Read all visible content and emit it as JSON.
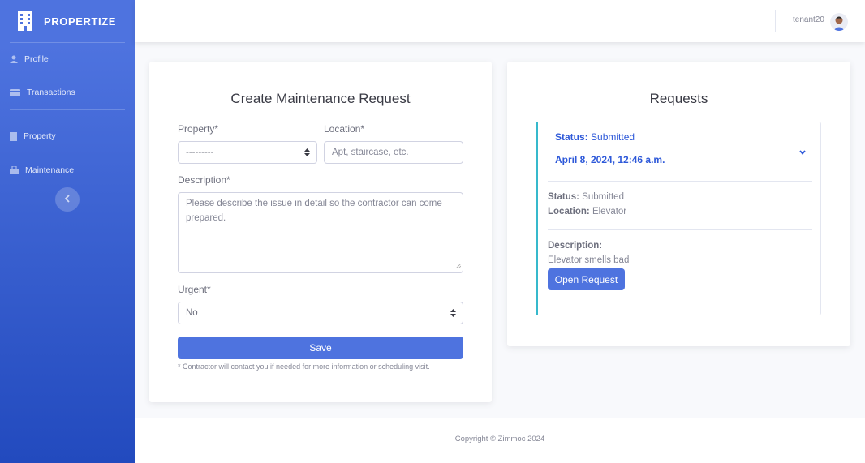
{
  "brand": {
    "name": "PROPERTIZE"
  },
  "sidebar": {
    "items": [
      {
        "label": "Profile",
        "icon": "user-icon"
      },
      {
        "label": "Transactions",
        "icon": "credit-card-icon"
      },
      {
        "label": "Property",
        "icon": "building-icon"
      },
      {
        "label": "Maintenance",
        "icon": "toolbox-icon"
      }
    ]
  },
  "topbar": {
    "username": "tenant20"
  },
  "form": {
    "title": "Create Maintenance Request",
    "property_label": "Property*",
    "property_value": "---------",
    "location_label": "Location*",
    "location_placeholder": "Apt, staircase, etc.",
    "description_label": "Description*",
    "description_placeholder": "Please describe the issue in detail so the contractor can come prepared.",
    "urgent_label": "Urgent*",
    "urgent_value": "No",
    "save_label": "Save",
    "note": "* Contractor will contact you if needed for more information or scheduling visit."
  },
  "requests": {
    "title": "Requests",
    "items": [
      {
        "status_key": "Status:",
        "status_value": "Submitted",
        "date": "April 8, 2024, 12:46 a.m.",
        "location_key": "Location:",
        "location_value": "Elevator",
        "description_key": "Description:",
        "description_value": "Elevator smells bad",
        "open_label": "Open Request"
      }
    ]
  },
  "footer": {
    "copyright": "Copyright © Zimmoc 2024"
  },
  "colors": {
    "primary": "#4e73df",
    "primary_dark": "#224abe",
    "accent_border": "#36b9cc"
  }
}
